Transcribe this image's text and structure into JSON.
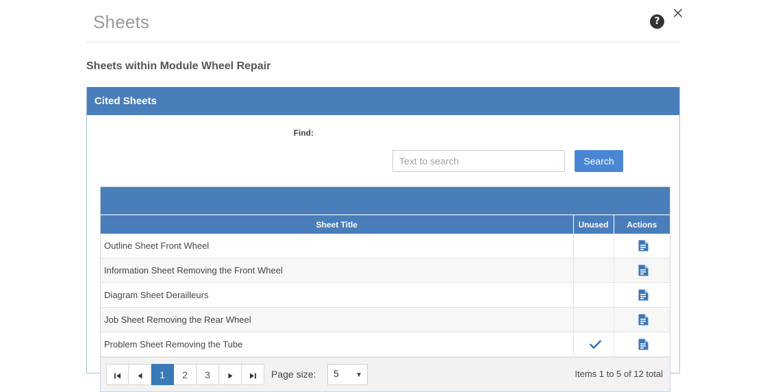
{
  "window": {
    "title": "Sheets",
    "help_icon": "help-circle-icon",
    "close_icon": "close-icon",
    "help_glyph": "?"
  },
  "subtitle": "Sheets within Module Wheel Repair",
  "panel": {
    "header": "Cited Sheets",
    "accent_color": "#4a7ebb",
    "border_color": "#a8c0dd"
  },
  "search": {
    "label": "Find:",
    "placeholder": "Text to search",
    "value": "",
    "button_label": "Search",
    "button_color": "#4a86d4"
  },
  "table": {
    "columns": [
      "Sheet Title",
      "Unused",
      "Actions"
    ],
    "rows": [
      {
        "title": "Outline Sheet Front Wheel",
        "unused": false,
        "action_icon": "document-icon"
      },
      {
        "title": "Information Sheet Removing the Front Wheel",
        "unused": false,
        "action_icon": "document-icon"
      },
      {
        "title": "Diagram Sheet Derailleurs",
        "unused": false,
        "action_icon": "document-icon"
      },
      {
        "title": "Job Sheet Removing the Rear Wheel",
        "unused": false,
        "action_icon": "document-icon"
      },
      {
        "title": "Problem Sheet Removing the Tube",
        "unused": true,
        "action_icon": "document-icon"
      }
    ],
    "check_icon": "check-icon",
    "icon_color": "#4a7ebb"
  },
  "pager": {
    "first_label": "⏮",
    "prev_label": "◀",
    "next_label": "▶",
    "last_label": "⏭",
    "pages": [
      "1",
      "2",
      "3"
    ],
    "active_page": "1",
    "active_color": "#3a7ab8",
    "page_size_label": "Page size:",
    "page_size_value": "5",
    "page_size_caret": "▼",
    "items_total": "Items 1 to 5 of 12 total"
  }
}
